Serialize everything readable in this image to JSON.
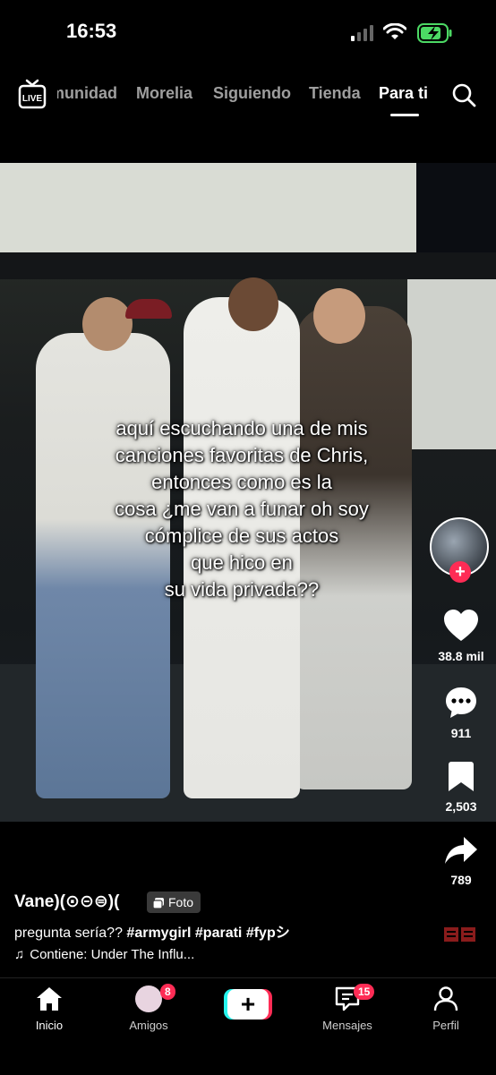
{
  "status_bar": {
    "time": "16:53",
    "signal_icon": "cellular-signal-icon",
    "wifi_icon": "wifi-icon",
    "battery_icon": "battery-charging-icon",
    "battery_color": "#4cd964"
  },
  "top_nav": {
    "live_icon": "live-icon",
    "live_label": "LIVE",
    "tabs": [
      {
        "label": "Comunidad",
        "visible_text": "munidad"
      },
      {
        "label": "Morelia"
      },
      {
        "label": "Siguiendo"
      },
      {
        "label": "Tienda"
      },
      {
        "label": "Para ti",
        "active": true
      }
    ],
    "search_icon": "search-icon"
  },
  "video": {
    "caption_lines": [
      "aquí escuchando una de mis",
      "canciones favoritas de Chris,",
      "entonces como es la",
      "cosa ¿me van a funar oh soy",
      "cómplice de sus actos",
      "que hico en",
      "su vida privada??"
    ]
  },
  "actions": {
    "follow_symbol": "+",
    "likes": "38.8 mil",
    "comments": "911",
    "saves": "2,503",
    "shares": "789",
    "accent": "#fe2c55"
  },
  "post": {
    "author": "Vane)(⊙⊝⊜)(",
    "badge": "Foto",
    "description_text": "pregunta sería?? ",
    "hashtags": "#armygirl #parati #fypシ",
    "music": "Contiene: Under The Influ..."
  },
  "bottom_nav": {
    "home": "Inicio",
    "friends": "Amigos",
    "friends_badge": "8",
    "create_symbol": "+",
    "inbox": "Mensajes",
    "inbox_badge": "15",
    "profile": "Perfil"
  }
}
